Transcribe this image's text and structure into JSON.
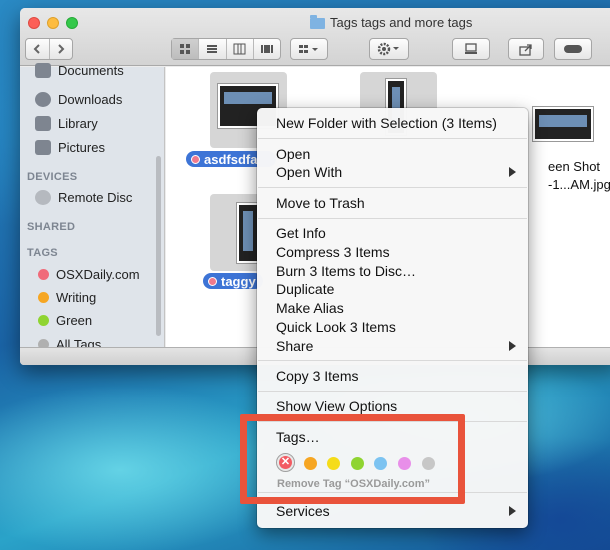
{
  "window": {
    "title": "Tags tags and more tags"
  },
  "toolbar": {
    "back_icon": "chevron-left-icon",
    "forward_icon": "chevron-right-icon",
    "view_modes": [
      "icon-view-icon",
      "list-view-icon",
      "column-view-icon",
      "cover-flow-icon"
    ],
    "arrange_icon": "arrange-grid-icon",
    "action_icon": "gear-icon",
    "share_icon": "share-icon",
    "tag_icon": "tag-toggle-icon"
  },
  "sidebar": {
    "favorites": [
      {
        "label": "Documents",
        "icon": "documents-icon"
      },
      {
        "label": "Downloads",
        "icon": "downloads-icon"
      },
      {
        "label": "Library",
        "icon": "folder-icon"
      },
      {
        "label": "Pictures",
        "icon": "camera-icon"
      }
    ],
    "devices_heading": "DEVICES",
    "devices": [
      {
        "label": "Remote Disc",
        "icon": "disc-icon"
      }
    ],
    "shared_heading": "SHARED",
    "tags_heading": "TAGS",
    "tags": [
      {
        "label": "OSXDaily.com",
        "color": "#f06b7a"
      },
      {
        "label": "Writing",
        "color": "#f6a623"
      },
      {
        "label": "Green",
        "color": "#8fd431"
      },
      {
        "label": "All Tags...",
        "color": "#b0b0b0"
      }
    ]
  },
  "files": [
    {
      "label": "asdfsdfa",
      "selected": true
    },
    {
      "label": "taggy",
      "selected": true
    },
    {
      "label_line1": "Screen Shot",
      "label_line2": "...-1...AM.jpg",
      "visible_line1": "een Shot",
      "visible_line2": "-1...AM.jpg"
    }
  ],
  "context_menu": {
    "new_folder": "New Folder with Selection (3 Items)",
    "open": "Open",
    "open_with": "Open With",
    "move_to_trash": "Move to Trash",
    "get_info": "Get Info",
    "compress": "Compress 3 Items",
    "burn": "Burn 3 Items to Disc…",
    "duplicate": "Duplicate",
    "make_alias": "Make Alias",
    "quick_look": "Quick Look 3 Items",
    "share": "Share",
    "copy": "Copy 3 Items",
    "show_view_options": "Show View Options",
    "tags": "Tags…",
    "tag_colors": [
      "#f6a623",
      "#f5dc19",
      "#8fd431",
      "#7cc3f1",
      "#e88fe9",
      "#c7c7c7"
    ],
    "remove_tag_color": "#f25b63",
    "remove_tag_label": "Remove Tag “OSXDaily.com”",
    "services": "Services"
  },
  "annotation": {
    "highlight_color": "#e9533b"
  }
}
